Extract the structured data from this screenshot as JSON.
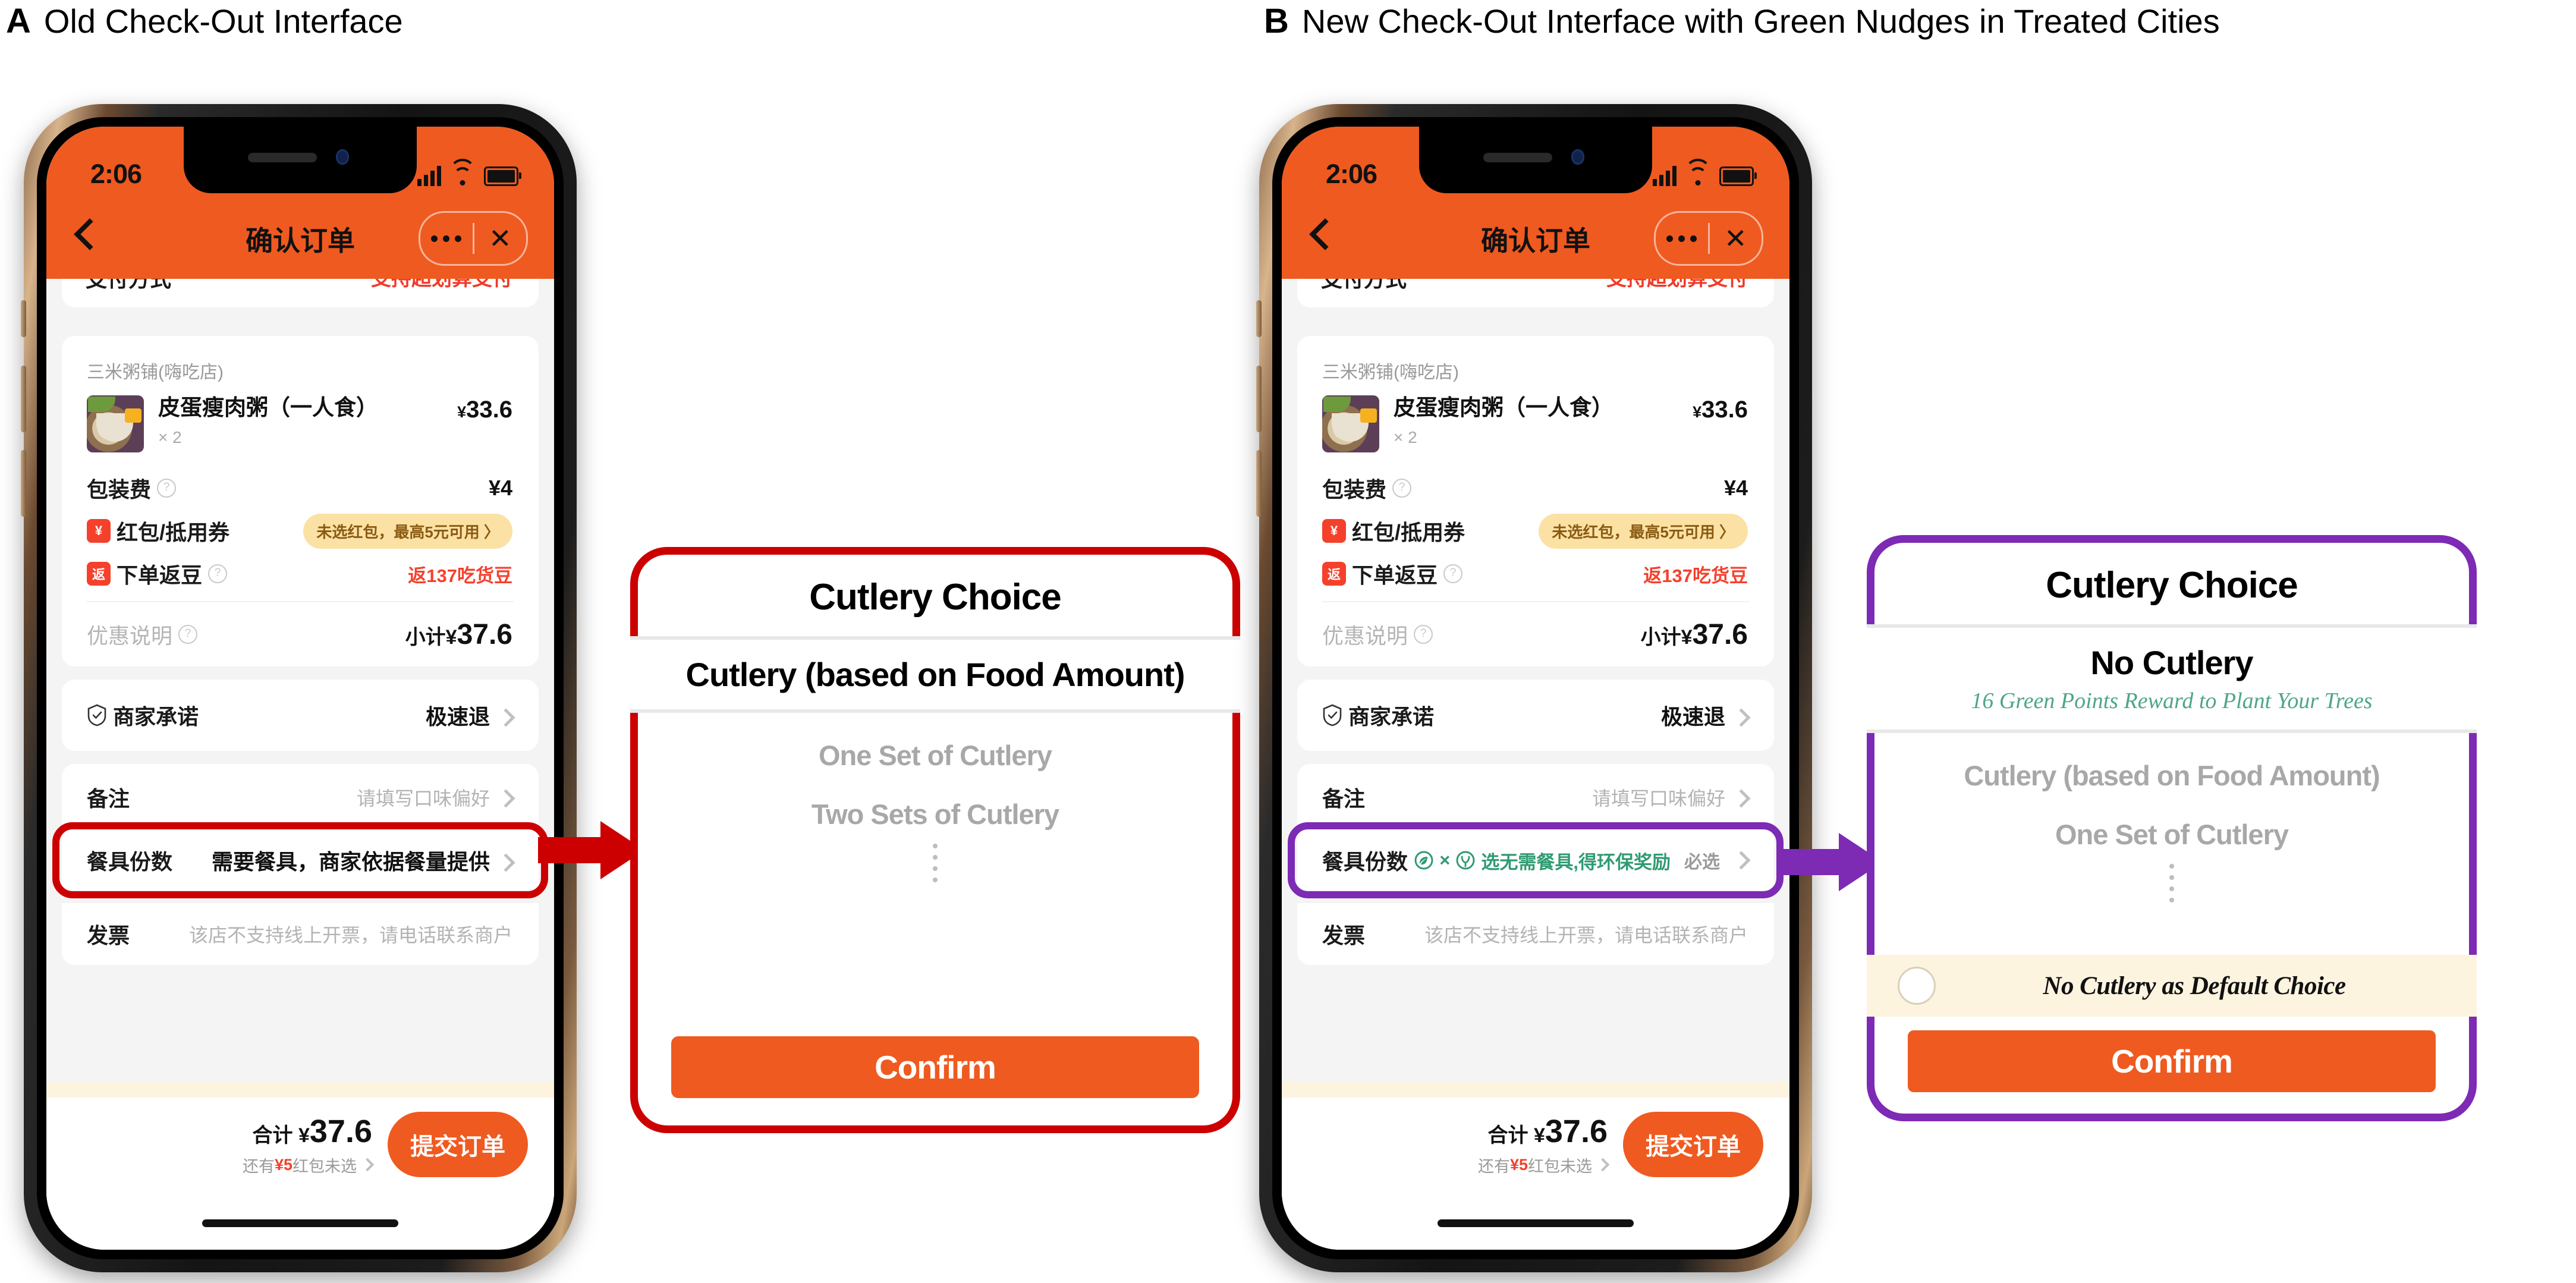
{
  "panels": {
    "a": {
      "letter": "A",
      "title": "Old Check-Out Interface"
    },
    "b": {
      "letter": "B",
      "title": "New Check-Out Interface with Green Nudges in Treated Cities"
    }
  },
  "phone": {
    "status": {
      "time": "2:06"
    },
    "nav": {
      "title": "确认订单",
      "close": "✕"
    },
    "clipped_row": {
      "left": "支付方式",
      "right": "支持超划算支付"
    },
    "shop": {
      "name": "三米粥铺(嗨吃店)"
    },
    "item": {
      "name": "皮蛋瘦肉粥（一人食）",
      "qty": "× 2",
      "currency": "¥",
      "price": "33.6"
    },
    "packaging": {
      "label": "包装费",
      "value": "¥4"
    },
    "coupon": {
      "tag": "¥",
      "label": "红包/抵用券",
      "pill": "未选红包，最高5元可用 〉"
    },
    "beans": {
      "tag": "返",
      "label": "下单返豆",
      "value": "返137吃货豆"
    },
    "discount": {
      "label": "优惠说明",
      "prefix": "小计¥",
      "value": "37.6"
    },
    "promise": {
      "label": "商家承诺",
      "value": "极速退"
    },
    "note": {
      "label": "备注",
      "placeholder": "请填写口味偏好"
    },
    "invoice": {
      "label": "发票",
      "value": "该店不支持线上开票，请电话联系商户"
    },
    "paybar": {
      "total_label": "合计",
      "currency": "¥",
      "total": "37.6",
      "sub_prefix": "还有",
      "sub_amount": "¥5",
      "sub_suffix": "红包未选",
      "submit": "提交订单"
    }
  },
  "cutlery_row": {
    "label": "餐具份数",
    "old_value": "需要餐具，商家依据餐量提供",
    "new_value": "选无需餐具,得环保奖励",
    "new_required": "必选",
    "icon_leaf": "green-leaf-icon",
    "icon_x": "×",
    "icon_tree": "tree-sprout-icon"
  },
  "callouts": {
    "old": {
      "title": "Cutlery Choice",
      "accent": "#cc0000",
      "selected": "Cutlery (based on Food Amount)",
      "selected_sub": "",
      "options": [
        "One Set of Cutlery",
        "Two Sets of Cutlery"
      ],
      "confirm": "Confirm",
      "default_toggle": ""
    },
    "new": {
      "title": "Cutlery Choice",
      "accent": "#7d2ab5",
      "selected": "No Cutlery",
      "selected_sub": "16 Green Points Reward to Plant Your Trees",
      "options": [
        "Cutlery (based on Food Amount)",
        "One Set of Cutlery"
      ],
      "default_toggle": "No Cutlery as Default Choice",
      "confirm": "Confirm"
    }
  }
}
